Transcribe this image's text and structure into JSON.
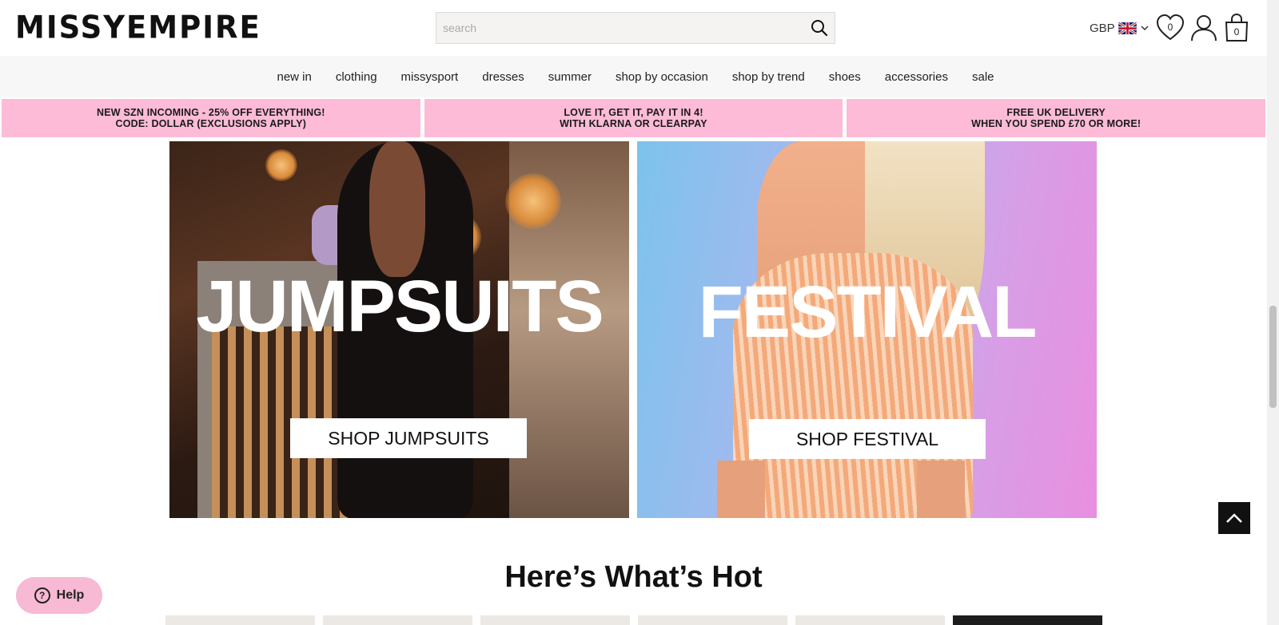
{
  "header": {
    "logo": "MISSYEMPIRE",
    "search_placeholder": "search",
    "currency": "GBP",
    "wishlist_count": "0",
    "bag_count": "0"
  },
  "nav": {
    "items": [
      "new in",
      "clothing",
      "missysport",
      "dresses",
      "summer",
      "shop by occasion",
      "shop by trend",
      "shoes",
      "accessories",
      "sale"
    ]
  },
  "promos": [
    {
      "line1": "NEW SZN INCOMING - 25% OFF EVERYTHING!",
      "line2": "CODE: DOLLAR (EXCLUSIONS APPLY)"
    },
    {
      "line1": "LOVE IT, GET IT, PAY IT IN 4!",
      "line2": "WITH KLARNA OR CLEARPAY"
    },
    {
      "line1": "FREE UK DELIVERY",
      "line2": "WHEN YOU SPEND £70 OR MORE!"
    }
  ],
  "banners": [
    {
      "title": "JUMPSUITS",
      "button": "SHOP JUMPSUITS"
    },
    {
      "title": "FESTIVAL",
      "button": "SHOP FESTIVAL"
    }
  ],
  "section_heading": "Here’s What’s Hot",
  "help_label": "Help",
  "colors": {
    "promo_pink": "#fdbbd7",
    "help_pink": "#f7b9d3",
    "nav_bg": "#f7f7f7"
  },
  "icons": [
    "search-icon",
    "uk-flag-icon",
    "chevron-down-icon",
    "heart-icon",
    "user-icon",
    "bag-icon",
    "question-icon",
    "chevron-up-icon"
  ]
}
